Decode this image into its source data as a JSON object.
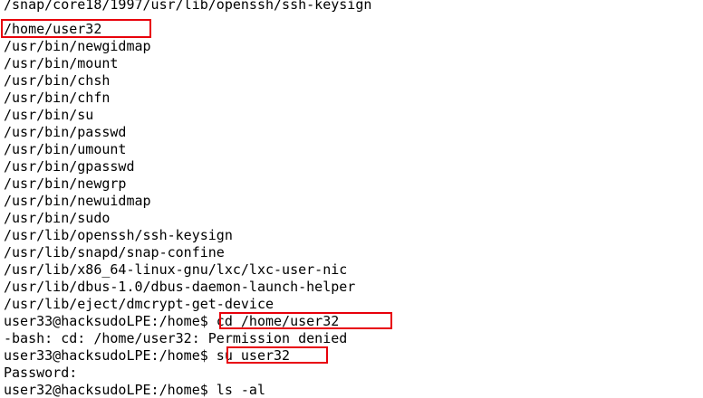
{
  "terminal": {
    "lines": [
      "/snap/core18/1997/usr/lib/openssh/ssh-keysign",
      "/home/user32",
      "/usr/bin/newgidmap",
      "/usr/bin/mount",
      "/usr/bin/chsh",
      "/usr/bin/chfn",
      "/usr/bin/su",
      "/usr/bin/passwd",
      "/usr/bin/umount",
      "/usr/bin/gpasswd",
      "/usr/bin/newgrp",
      "/usr/bin/newuidmap",
      "/usr/bin/sudo",
      "/usr/lib/openssh/ssh-keysign",
      "/usr/lib/snapd/snap-confine",
      "/usr/lib/x86_64-linux-gnu/lxc/lxc-user-nic",
      "/usr/lib/dbus-1.0/dbus-daemon-launch-helper",
      "/usr/lib/eject/dmcrypt-get-device"
    ],
    "cmd1": {
      "prompt": "user33@hacksudoLPE:/home$",
      "command": " cd /home/user32"
    },
    "error": "-bash: cd: /home/user32: Permission denied",
    "cmd2": {
      "prompt": "user33@hacksudoLPE:/home$",
      "command": " su user32"
    },
    "password": "Password:",
    "cmd3": {
      "prompt": "user32@hacksudoLPE:/home$",
      "command": " ls -al"
    }
  },
  "colors": {
    "highlight": "#e8000b",
    "text": "#000000",
    "background": "#ffffff"
  }
}
